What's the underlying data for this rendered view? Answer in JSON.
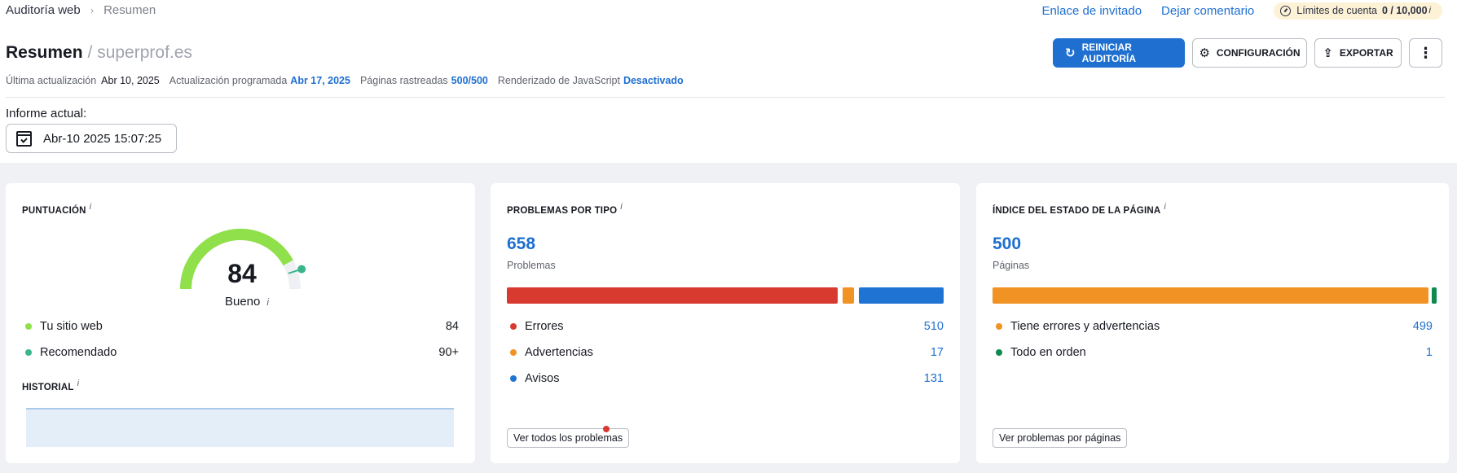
{
  "breadcrumb": {
    "root": "Auditoría web",
    "current": "Resumen"
  },
  "header_links": {
    "guest_link": "Enlace de invitado",
    "feedback": "Dejar comentario"
  },
  "limits": {
    "label": "Límites de cuenta",
    "value": "0 / 10,000",
    "info": "i"
  },
  "title": {
    "main": "Resumen",
    "domain": "/ superprof.es"
  },
  "meta": {
    "last_update_label": "Última actualización",
    "last_update_value": "Abr 10, 2025",
    "scheduled_label": "Actualización programada",
    "scheduled_value": "Abr 17, 2025",
    "pages_label": "Páginas rastreadas",
    "pages_value": "500/500",
    "js_label": "Renderizado de JavaScript",
    "js_value": "Desactivado"
  },
  "actions": {
    "restart": "REINICIAR AUDITORÍA",
    "config": "CONFIGURACIÓN",
    "export": "EXPORTAR",
    "more": "⋮"
  },
  "report": {
    "label": "Informe actual:",
    "date": "Abr-10 2025 15:07:25"
  },
  "score_card": {
    "title": "PUNTUACIÓN",
    "info": "i",
    "score": "84",
    "score_fraction": 0.84,
    "status": "Bueno",
    "legend": [
      {
        "label": "Tu sitio web",
        "value": "84",
        "color": "#8fe04a"
      },
      {
        "label": "Recomendado",
        "value": "90+",
        "color": "#3bb58a"
      }
    ],
    "history_title": "HISTORIAL"
  },
  "issues_card": {
    "title": "PROBLEMAS POR TIPO",
    "info": "i",
    "total": "658",
    "total_label": "Problemas",
    "items": [
      {
        "label": "Errores",
        "value": "510",
        "count": 510,
        "color": "#d93a30"
      },
      {
        "label": "Advertencias",
        "value": "17",
        "count": 17,
        "color": "#f19224"
      },
      {
        "label": "Avisos",
        "value": "131",
        "count": 131,
        "color": "#1f74d3"
      }
    ],
    "button": "Ver todos los problemas"
  },
  "pages_card": {
    "title": "ÍNDICE DEL ESTADO DE LA PÁGINA",
    "info": "i",
    "total": "500",
    "total_label": "Páginas",
    "items": [
      {
        "label": "Tiene errores y advertencias",
        "value": "499",
        "count": 499,
        "color": "#f19224"
      },
      {
        "label": "Todo en orden",
        "value": "1",
        "count": 1,
        "color": "#0e8a4e"
      }
    ],
    "button": "Ver problemas por páginas"
  },
  "colors": {
    "accent": "#1e6fd0",
    "gauge_green": "#8fe04a",
    "gauge_bg": "#eef0f3"
  }
}
